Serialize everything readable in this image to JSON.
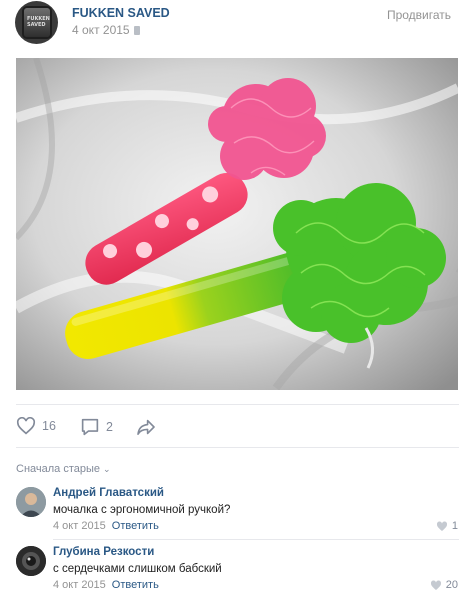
{
  "post": {
    "author": "FUKKEN SAVED",
    "date": "4 окт 2015",
    "promote": "Продвигать",
    "avatar_label": "FUKKEN SAVED",
    "image_alt": "",
    "likes": "16",
    "comments": "2"
  },
  "comments_section": {
    "sort_label": "Сначала старые",
    "items": [
      {
        "author": "Андрей Главатский",
        "text": "мочалка с эргономичной ручкой?",
        "date": "4 окт 2015",
        "reply": "Ответить",
        "likes": "1"
      },
      {
        "author": "Глубина Резкости",
        "text": "с сердечками слишком бабский",
        "date": "4 окт 2015",
        "reply": "Ответить",
        "likes": "20"
      }
    ]
  },
  "colors": {
    "link": "#2a5885",
    "muted": "#939393",
    "icon": "#828a99",
    "divider": "#e7e8ec"
  },
  "icons": [
    "heart-icon",
    "comment-icon",
    "share-icon",
    "chevron-down-icon",
    "phone-icon"
  ]
}
